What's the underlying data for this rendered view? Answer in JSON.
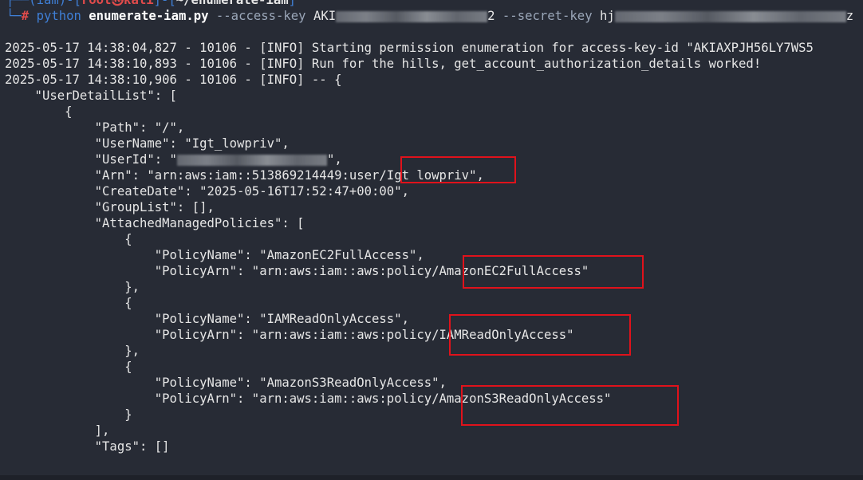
{
  "prompt": {
    "env": "iam",
    "user_host": "root㉿kali",
    "cwd": "~/enumerate-iam",
    "hash": "#"
  },
  "command": {
    "interpreter": "python",
    "script": "enumerate-iam.py",
    "flag_access": "--access-key",
    "access_prefix": "AKI",
    "access_suffix": "2",
    "flag_secret": "--secret-key",
    "secret_prefix": "hj",
    "secret_suffix": "z"
  },
  "log_lines": [
    "2025-05-17 14:38:04,827 - 10106 - [INFO] Starting permission enumeration for access-key-id \"AKIAXPJH56LY7WS5",
    "2025-05-17 14:38:10,893 - 10106 - [INFO] Run for the hills, get_account_authorization_details worked!",
    "2025-05-17 14:38:10,906 - 10106 - [INFO] -- {"
  ],
  "json_lines": [
    "    \"UserDetailList\": [",
    "        {",
    "            \"Path\": \"/\",",
    "            \"UserName\": \"Igt_lowpriv\",",
    "            \"UserId\": \"",
    "            \"Arn\": \"arn:aws:iam::513869214449:user/Igt_lowpriv\",",
    "            \"CreateDate\": \"2025-05-16T17:52:47+00:00\",",
    "            \"GroupList\": [],",
    "            \"AttachedManagedPolicies\": [",
    "                {",
    "                    \"PolicyName\": \"AmazonEC2FullAccess\",",
    "                    \"PolicyArn\": \"arn:aws:iam::aws:policy/AmazonEC2FullAccess\"",
    "                },",
    "                {",
    "                    \"PolicyName\": \"IAMReadOnlyAccess\",",
    "                    \"PolicyArn\": \"arn:aws:iam::aws:policy/IAMReadOnlyAccess\"",
    "                },",
    "                {",
    "                    \"PolicyName\": \"AmazonS3ReadOnlyAccess\",",
    "                    \"PolicyArn\": \"arn:aws:iam::aws:policy/AmazonS3ReadOnlyAccess\"",
    "                }",
    "            ],",
    "            \"Tags\": []"
  ],
  "userid_suffix": "\",",
  "colors": {
    "background": "#272b35",
    "text": "#e6e6e6",
    "prompt_blue": "#3f7fd6",
    "prompt_red": "#e04b4b",
    "highlight_red": "#e0121b"
  }
}
